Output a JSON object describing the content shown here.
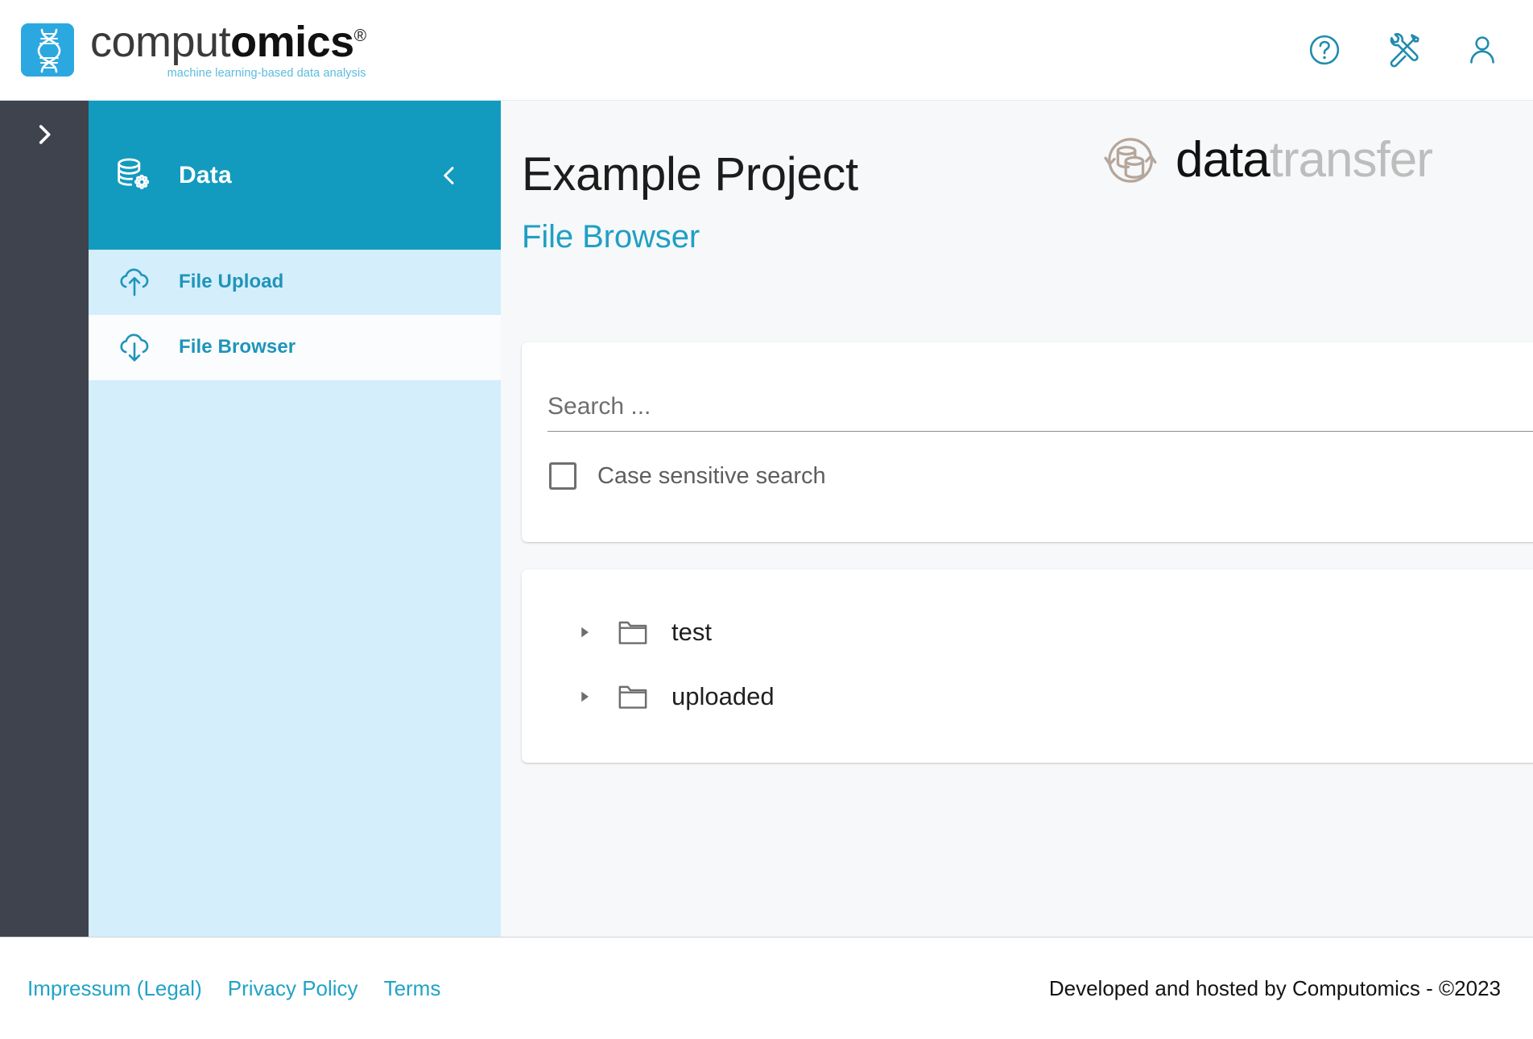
{
  "header": {
    "brand": {
      "logo_icon": "dna-helix-logo-icon",
      "word_first": "comput",
      "word_second": "omics",
      "registered_mark": "®",
      "tagline": "machine learning-based data analysis"
    },
    "actions": [
      {
        "name": "help-icon",
        "label": "Help"
      },
      {
        "name": "tools-icon",
        "label": "Tools"
      },
      {
        "name": "user-account-icon",
        "label": "Account"
      }
    ]
  },
  "rail": {
    "expand_icon": "chevron-right-icon"
  },
  "sidebar": {
    "group": {
      "label": "Data",
      "icon": "database-gear-icon",
      "collapse_icon": "chevron-left-icon"
    },
    "items": [
      {
        "label": "File Upload",
        "icon": "cloud-upload-icon",
        "active": false
      },
      {
        "label": "File Browser",
        "icon": "cloud-download-icon",
        "active": true
      }
    ]
  },
  "main": {
    "title": "Example Project",
    "subtitle": "File Browser",
    "product_logo": {
      "icon": "datatransfer-databases-icon",
      "text_bold": "data",
      "text_light": "transfer"
    },
    "search": {
      "value": "",
      "placeholder": "Search ...",
      "search_icon": "search-icon",
      "case_sensitive_label": "Case sensitive search",
      "case_sensitive_checked": false
    },
    "tree": {
      "rows": [
        {
          "name": "test",
          "icon": "folder-icon",
          "caret": "caret-right-icon",
          "expanded": false
        },
        {
          "name": "uploaded",
          "icon": "folder-icon",
          "caret": "caret-right-icon",
          "expanded": false
        }
      ]
    }
  },
  "footer": {
    "links": [
      {
        "label": "Impressum (Legal)"
      },
      {
        "label": "Privacy Policy"
      },
      {
        "label": "Terms"
      }
    ],
    "credit": "Developed and hosted by Computomics - ©2023"
  },
  "colors": {
    "brand_cyan": "#2BA8E0",
    "sidebar_header": "#129BBE",
    "sidebar_bg": "#D4EEFB",
    "rail_dark": "#3F434E",
    "accent_teal": "#1F94BA",
    "main_bg": "#F6F8F9",
    "logo_taupe": "#B5A69B"
  }
}
